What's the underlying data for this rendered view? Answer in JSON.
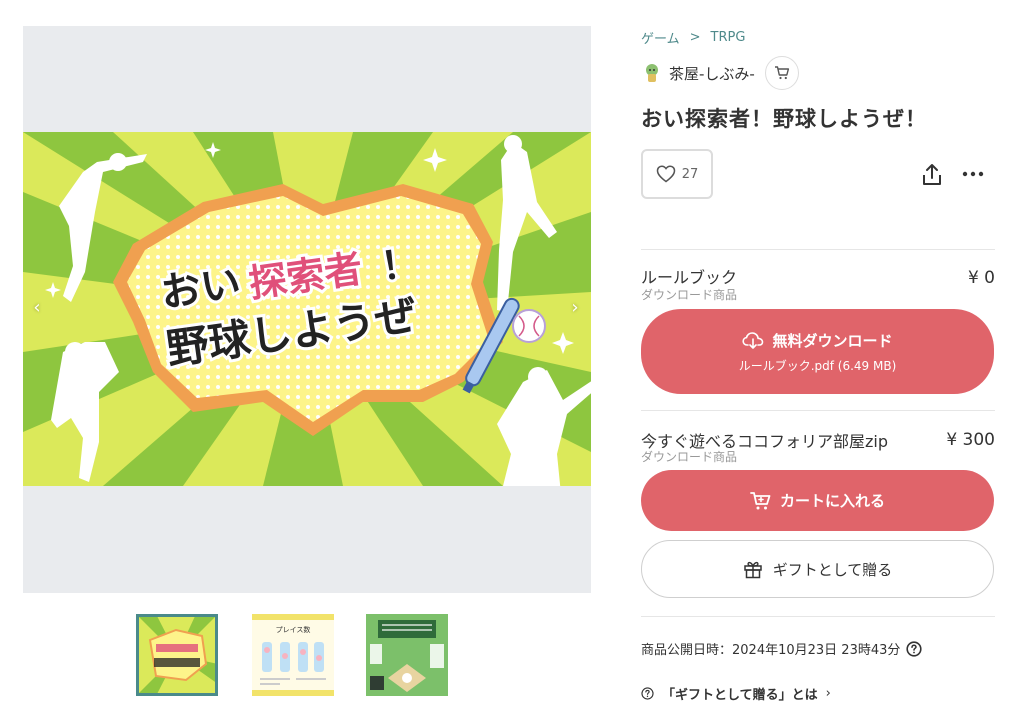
{
  "breadcrumb": {
    "category": "ゲーム",
    "separator": ">",
    "subcategory": "TRPG"
  },
  "shop": {
    "name": "茶屋-しぶみ-"
  },
  "product": {
    "title": "おい探索者！野球しようぜ！",
    "likes": "27"
  },
  "hero_image": {
    "line1_a": "おい",
    "line1_b": "探索者",
    "line1_c": "！",
    "line2": "野球しようぜ"
  },
  "thumbnails": [
    {
      "label": "main-art",
      "active": true
    },
    {
      "label": "play-sheet",
      "active": false
    },
    {
      "label": "field-map",
      "active": false
    }
  ],
  "thumb2_caption": "プレイス数",
  "items": [
    {
      "name": "ルールブック",
      "type": "ダウンロード商品",
      "price": "¥ 0",
      "button_label": "無料ダウンロード",
      "button_sub": "ルールブック.pdf (6.49 MB)"
    },
    {
      "name": "今すぐ遊べるココフォリア部屋zip",
      "type": "ダウンロード商品",
      "price": "¥ 300",
      "button_label": "カートに入れる"
    }
  ],
  "gift_button": "ギフトとして贈る",
  "published": "商品公開日時：2024年10月23日 23時43分",
  "gift_help": "「ギフトとして贈る」とは",
  "colors": {
    "accent_red": "#e0646a",
    "breadcrumb_teal": "#4f8a8b",
    "thumb_active": "#4a8a8a"
  }
}
